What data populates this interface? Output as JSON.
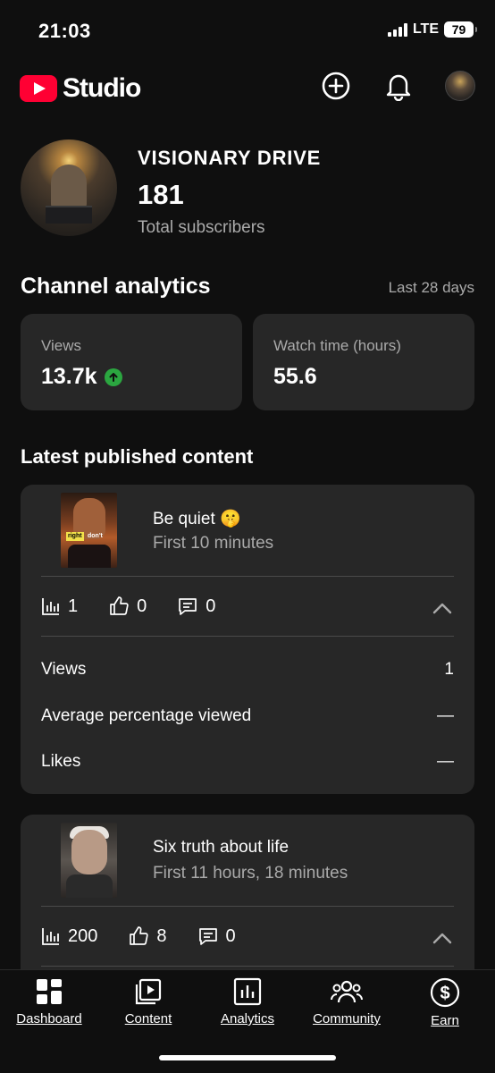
{
  "status_bar": {
    "time": "21:03",
    "network": "LTE",
    "battery": "79"
  },
  "header": {
    "logo_text": "Studio",
    "icons": [
      "add-circle-icon",
      "bell-icon",
      "avatar"
    ]
  },
  "channel": {
    "name": "VISIONARY DRIVE",
    "subscribers": "181",
    "subscribers_label": "Total subscribers"
  },
  "analytics": {
    "title": "Channel analytics",
    "range": "Last 28 days",
    "cards": [
      {
        "label": "Views",
        "value": "13.7k",
        "trend": "up"
      },
      {
        "label": "Watch time (hours)",
        "value": "55.6"
      }
    ]
  },
  "latest": {
    "title": "Latest published content",
    "items": [
      {
        "title": "Be quiet 🤫",
        "subtitle": "First 10 minutes",
        "thumb_text_a": "right",
        "thumb_text_b": "don't",
        "views": "1",
        "likes": "0",
        "comments": "0",
        "details": [
          {
            "label": "Views",
            "value": "1"
          },
          {
            "label": "Average percentage viewed",
            "value": "—"
          },
          {
            "label": "Likes",
            "value": "—"
          }
        ]
      },
      {
        "title": "Six truth about life",
        "subtitle": "First 11 hours, 18 minutes",
        "views": "200",
        "likes": "8",
        "comments": "0"
      }
    ]
  },
  "bottom_nav": {
    "items": [
      {
        "label": "Dashboard",
        "icon": "dashboard-icon"
      },
      {
        "label": "Content",
        "icon": "content-icon"
      },
      {
        "label": "Analytics",
        "icon": "analytics-icon"
      },
      {
        "label": "Community",
        "icon": "community-icon"
      },
      {
        "label": "Earn",
        "icon": "earn-icon"
      }
    ]
  },
  "colors": {
    "background": "#0f0f0f",
    "card": "#272727",
    "brand_red": "#ff0033",
    "trend_green": "#2ba640",
    "muted_text": "#aaaaaa"
  }
}
